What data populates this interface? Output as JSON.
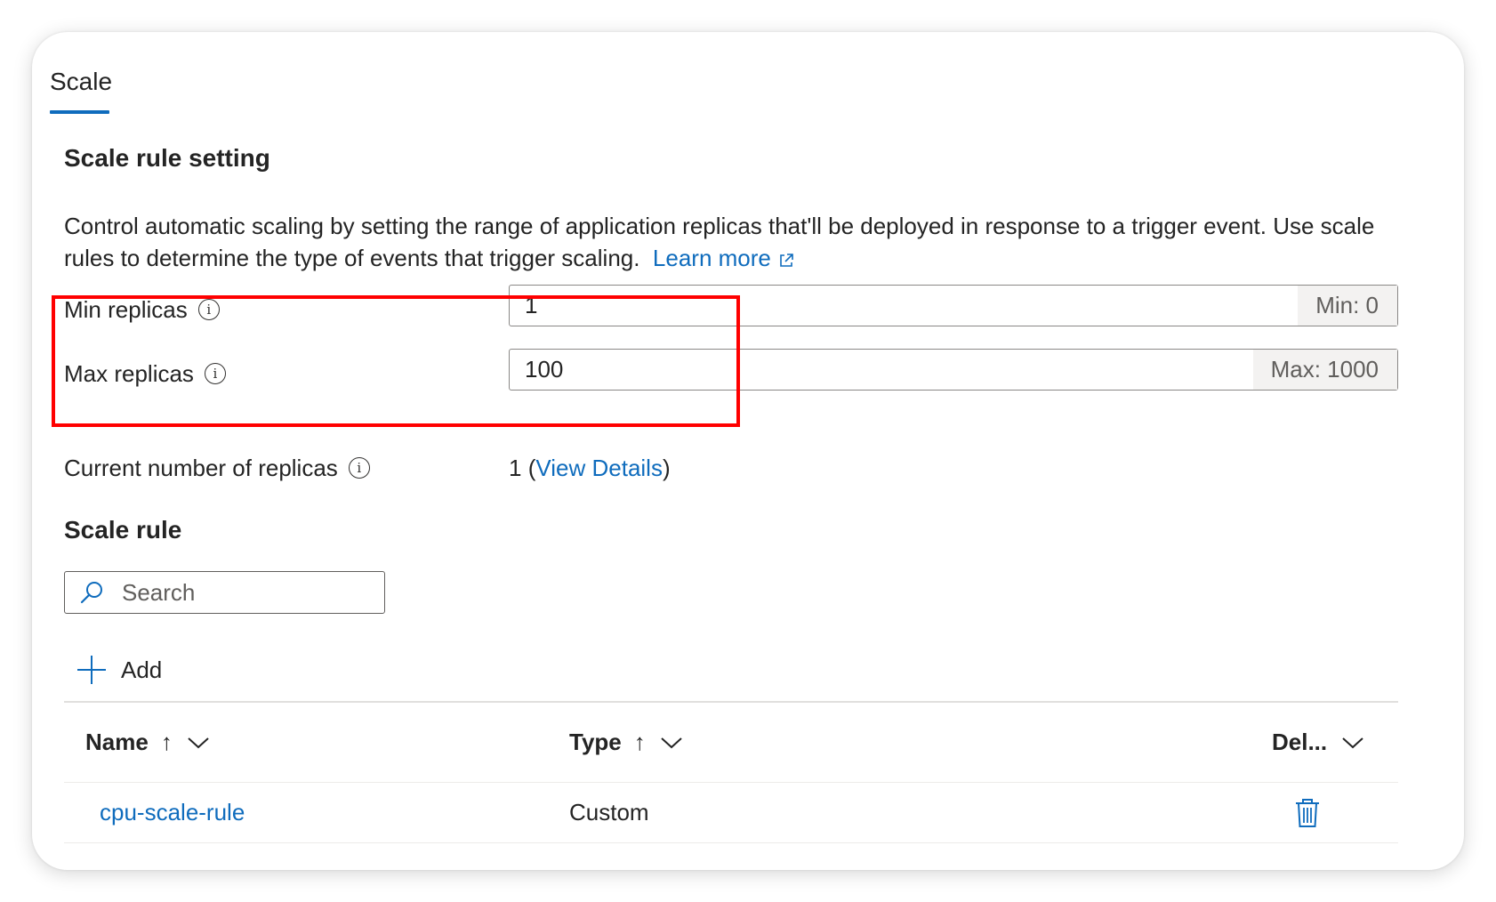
{
  "tabs": {
    "active": "Scale"
  },
  "section": {
    "title": "Scale rule setting",
    "description": "Control automatic scaling by setting the range of application replicas that'll be deployed in response to a trigger event. Use scale rules to determine the type of events that trigger scaling.",
    "learn_more": "Learn more"
  },
  "min_replicas": {
    "label": "Min replicas",
    "value": "1",
    "suffix": "Min: 0"
  },
  "max_replicas": {
    "label": "Max replicas",
    "value": "100",
    "suffix": "Max: 1000"
  },
  "current_replicas": {
    "label": "Current number of replicas",
    "count": "1",
    "open_paren": "(",
    "link": "View Details",
    "close_paren": ")"
  },
  "scale_rule": {
    "title": "Scale rule",
    "search_placeholder": "Search",
    "add_label": "Add",
    "columns": {
      "name": "Name",
      "type": "Type",
      "delete": "Del..."
    },
    "sort_arrow": "↑",
    "rows": [
      {
        "name": "cpu-scale-rule",
        "type": "Custom"
      }
    ]
  },
  "colors": {
    "accent": "#0f6cbd",
    "highlight": "#ff0000"
  },
  "icons": [
    "info-icon",
    "external-link-icon",
    "search-icon",
    "plus-icon",
    "chevron-down-icon",
    "trash-icon"
  ]
}
